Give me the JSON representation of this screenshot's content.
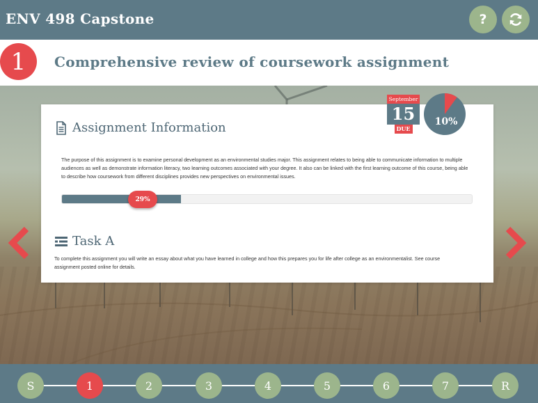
{
  "header": {
    "app_title": "ENV 498 Capstone",
    "help_label": "?",
    "refresh_icon": "refresh-icon"
  },
  "assignment": {
    "number": "1",
    "title": "Comprehensive review of coursework assignment"
  },
  "due": {
    "month": "September",
    "day": "15",
    "label": "DUE"
  },
  "grade_weight": {
    "label": "10%",
    "fraction": 0.1
  },
  "info": {
    "icon": "document-icon",
    "heading": "Assignment Information",
    "description": "The purpose of this assignment is to examine personal development as an environmental studies major. This assignment relates to being able to communicate information to multiple audiences as well as demonstrate information literacy, two learning outcomes associated with your degree. It also can be linked with the first learning outcome of this course, being able to describe how coursework from different disciplines provides new perspectives on environmental issues."
  },
  "progress": {
    "label": "29%",
    "fraction": 0.29
  },
  "task": {
    "icon": "list-icon",
    "heading": "Task A",
    "text": "To complete this assignment you will write an essay about what you have learned in college and how this prepares you for life after college as an environmentalist. See course assignment posted online for details."
  },
  "navigation": {
    "prev_icon": "chevron-left-icon",
    "next_icon": "chevron-right-icon",
    "steps": [
      "S",
      "1",
      "2",
      "3",
      "4",
      "5",
      "6",
      "7",
      "R"
    ],
    "active_step": "1"
  },
  "colors": {
    "slate": "#5d7a87",
    "accent_red": "#e64a4d",
    "sage": "#9cb58c",
    "white": "#ffffff"
  }
}
